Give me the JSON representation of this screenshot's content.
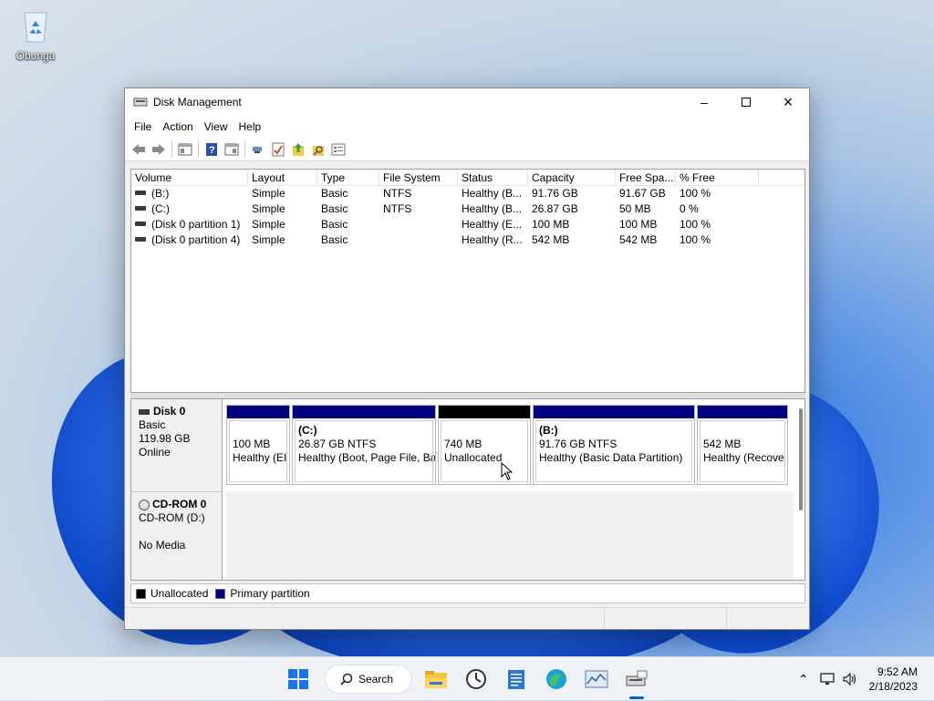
{
  "desktop": {
    "recycle_bin_label": "Obunga"
  },
  "window": {
    "title": "Disk Management",
    "icon": "disk-management-icon",
    "controls": [
      "minimize",
      "maximize",
      "close"
    ],
    "menu": [
      "File",
      "Action",
      "View",
      "Help"
    ],
    "toolbar_icons": [
      "back-icon",
      "forward-icon",
      "console-tree-icon",
      "help-icon",
      "properties-icon",
      "connect-icon",
      "check-icon",
      "up-icon",
      "find-icon",
      "settings-icon"
    ]
  },
  "volume_list": {
    "columns": [
      "Volume",
      "Layout",
      "Type",
      "File System",
      "Status",
      "Capacity",
      "Free Spa...",
      "% Free"
    ],
    "rows": [
      {
        "volume": "(B:)",
        "layout": "Simple",
        "type": "Basic",
        "fs": "NTFS",
        "status": "Healthy (B...",
        "capacity": "91.76 GB",
        "free": "91.67 GB",
        "pct": "100 %"
      },
      {
        "volume": "(C:)",
        "layout": "Simple",
        "type": "Basic",
        "fs": "NTFS",
        "status": "Healthy (B...",
        "capacity": "26.87 GB",
        "free": "50 MB",
        "pct": "0 %"
      },
      {
        "volume": "(Disk 0 partition 1)",
        "layout": "Simple",
        "type": "Basic",
        "fs": "",
        "status": "Healthy (E...",
        "capacity": "100 MB",
        "free": "100 MB",
        "pct": "100 %"
      },
      {
        "volume": "(Disk 0 partition 4)",
        "layout": "Simple",
        "type": "Basic",
        "fs": "",
        "status": "Healthy (R...",
        "capacity": "542 MB",
        "free": "542 MB",
        "pct": "100 %"
      }
    ]
  },
  "disk0": {
    "name": "Disk 0",
    "type": "Basic",
    "size": "119.98 GB",
    "state": "Online",
    "partitions": [
      {
        "name": "",
        "line1": "100 MB",
        "line2": "Healthy (EI",
        "kind": "primary"
      },
      {
        "name": "(C:)",
        "line1": "26.87 GB NTFS",
        "line2": "Healthy (Boot, Page File, Ba",
        "kind": "primary"
      },
      {
        "name": "",
        "line1": "740 MB",
        "line2": "Unallocated",
        "kind": "unallocated"
      },
      {
        "name": "(B:)",
        "line1": "91.76 GB NTFS",
        "line2": "Healthy (Basic Data Partition)",
        "kind": "primary"
      },
      {
        "name": "",
        "line1": "542 MB",
        "line2": "Healthy (Recove",
        "kind": "primary"
      }
    ]
  },
  "cdrom0": {
    "name": "CD-ROM 0",
    "drive": "CD-ROM (D:)",
    "media": "No Media"
  },
  "legend": {
    "unallocated": "Unallocated",
    "primary": "Primary partition"
  },
  "colors": {
    "primary_band": "#000080",
    "unallocated_band": "#000000"
  },
  "taskbar": {
    "search_label": "Search",
    "apps": [
      "start-icon",
      "search",
      "file-explorer-icon",
      "clock-app-icon",
      "notepad-icon",
      "edge-icon",
      "performance-monitor-icon",
      "disk-management-icon"
    ],
    "time": "9:52 AM",
    "date": "2/18/2023"
  }
}
